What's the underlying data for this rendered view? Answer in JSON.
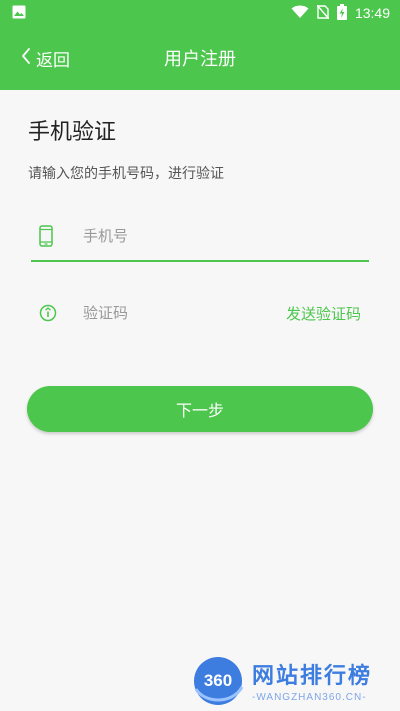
{
  "status_bar": {
    "time": "13:49",
    "icons": [
      "image-icon",
      "wifi-icon",
      "no-sim-icon",
      "battery-charging-icon"
    ]
  },
  "app_bar": {
    "back_label": "返回",
    "title": "用户注册"
  },
  "main": {
    "heading": "手机验证",
    "subheading": "请输入您的手机号码，进行验证",
    "phone_field": {
      "value": "",
      "placeholder": "手机号",
      "icon": "phone-icon"
    },
    "code_field": {
      "value": "",
      "placeholder": "验证码",
      "icon": "info-icon"
    },
    "send_code_label": "发送验证码",
    "next_label": "下一步"
  },
  "watermark": {
    "logo_text": "360",
    "title": "网站排行榜",
    "subtitle": "-WANGZHAN360.CN-"
  },
  "colors": {
    "accent": "#4cc64c",
    "background": "#f7f7f7",
    "watermark": "#3d7de0"
  }
}
